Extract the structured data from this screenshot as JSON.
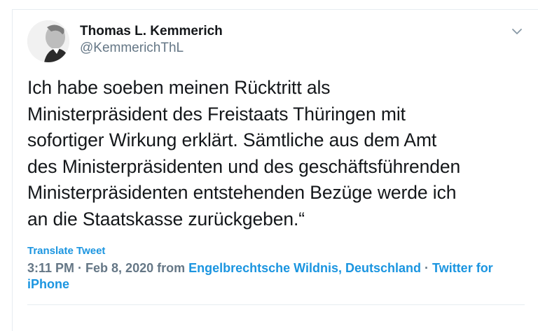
{
  "author": {
    "name": "Thomas L. Kemmerich",
    "handle": "@KemmerichThL"
  },
  "tweet": {
    "text": "Ich habe soeben meinen Rücktritt als\nMinisterpräsident des Freistaats Thüringen mit\nsofortiger Wirkung erklärt. Sämtliche aus dem Amt\ndes Ministerpräsidenten und des geschäftsführenden\nMinisterpräsidenten entstehenden Bezüge werde ich\nan die Staatskasse zurückgeben.“",
    "translate_label": "Translate Tweet"
  },
  "meta": {
    "time": "3:11 PM",
    "sep1": " · ",
    "date": "Feb 8, 2020",
    "from_label": " from ",
    "location": "Engelbrechtsche Wildnis, Deutschland",
    "sep2": " · ",
    "source": "Twitter for iPhone"
  },
  "icons": {
    "menu": "chevron-down-icon"
  },
  "colors": {
    "link": "#1b95e0",
    "text": "#14171a",
    "secondary": "#657786",
    "border": "#e6ecf0"
  }
}
